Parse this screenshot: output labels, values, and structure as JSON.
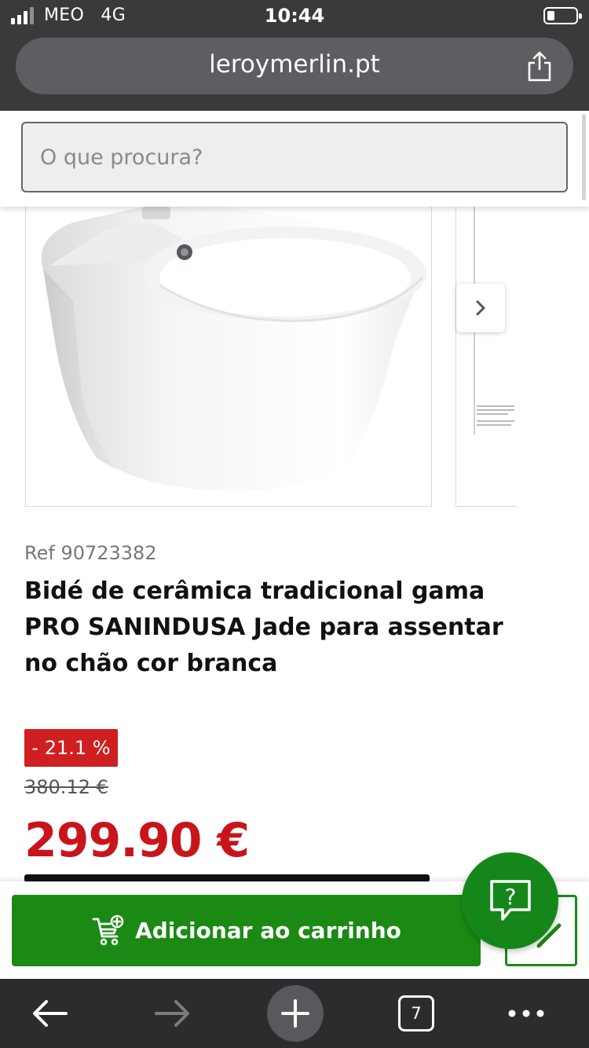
{
  "status_bar": {
    "carrier": "MEO",
    "network": "4G",
    "time": "10:44"
  },
  "browser": {
    "url": "leroymerlin.pt",
    "tabs_count": "7"
  },
  "search": {
    "placeholder": "O que procura?"
  },
  "product": {
    "ref": "Ref 90723382",
    "title": "Bidé de cerâmica tradicional gama PRO SANINDUSA Jade para assentar no chão cor branca",
    "discount": "- 21.1 %",
    "old_price": "380.12 €",
    "price": "299.90 €"
  },
  "cart": {
    "add_label": "Adicionar ao carrinho"
  },
  "help": {
    "label": "?"
  },
  "colors": {
    "brand_green": "#1b8a14",
    "price_red": "#c8151b",
    "discount_red": "#cf1f21"
  },
  "icons": [
    "signal-icon",
    "battery-icon",
    "share-icon",
    "chevron-right-icon",
    "cart-add-icon",
    "help-icon",
    "back-arrow-icon",
    "forward-arrow-icon",
    "plus-icon",
    "more-icon"
  ]
}
